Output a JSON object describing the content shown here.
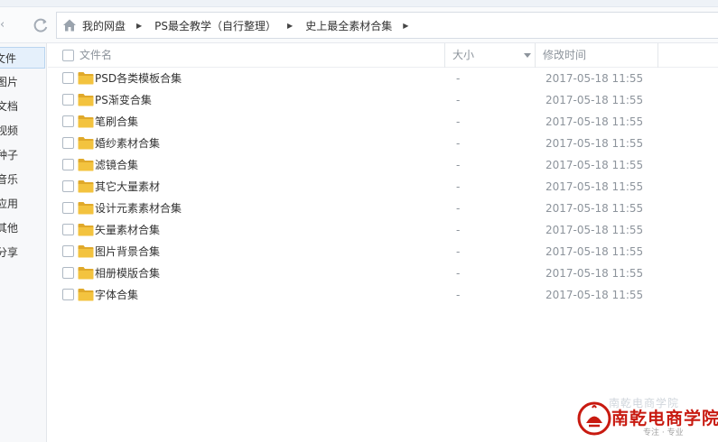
{
  "nav": {
    "back_glyph": "‹",
    "refresh_icon": "refresh-icon",
    "home_icon": "home-icon",
    "breadcrumbs": [
      "我的网盘",
      "PS最全教学（自行整理）",
      "史上最全素材合集"
    ]
  },
  "sidebar": {
    "items": [
      {
        "label": "文件",
        "active": true
      },
      {
        "label": "图片",
        "active": false
      },
      {
        "label": "文档",
        "active": false
      },
      {
        "label": "视频",
        "active": false
      },
      {
        "label": "种子",
        "active": false
      },
      {
        "label": "音乐",
        "active": false
      },
      {
        "label": "应用",
        "active": false
      },
      {
        "label": "其他",
        "active": false
      },
      {
        "label": "我的分享",
        "active": false
      }
    ]
  },
  "table": {
    "columns": {
      "name": "文件名",
      "size": "大小",
      "modified": "修改时间"
    },
    "rows": [
      {
        "name": "PSD各类模板合集",
        "size": "-",
        "modified": "2017-05-18 11:55"
      },
      {
        "name": "PS渐变合集",
        "size": "-",
        "modified": "2017-05-18 11:55"
      },
      {
        "name": "笔刷合集",
        "size": "-",
        "modified": "2017-05-18 11:55"
      },
      {
        "name": "婚纱素材合集",
        "size": "-",
        "modified": "2017-05-18 11:55"
      },
      {
        "name": "滤镜合集",
        "size": "-",
        "modified": "2017-05-18 11:55"
      },
      {
        "name": "其它大量素材",
        "size": "-",
        "modified": "2017-05-18 11:55"
      },
      {
        "name": "设计元素素材合集",
        "size": "-",
        "modified": "2017-05-18 11:55"
      },
      {
        "name": "矢量素材合集",
        "size": "-",
        "modified": "2017-05-18 11:55"
      },
      {
        "name": "图片背景合集",
        "size": "-",
        "modified": "2017-05-18 11:55"
      },
      {
        "name": "相册模版合集",
        "size": "-",
        "modified": "2017-05-18 11:55"
      },
      {
        "name": "字体合集",
        "size": "-",
        "modified": "2017-05-18 11:55"
      }
    ]
  },
  "watermark": {
    "name": "南乾电商学院",
    "slogan": "专注 · 专业",
    "faint_text": "南乾电商学院"
  },
  "colors": {
    "folder": "#f3c33f",
    "folder_dark": "#e0a92a",
    "brand_red": "#c81a10",
    "active_bg": "#e5f0fb"
  }
}
